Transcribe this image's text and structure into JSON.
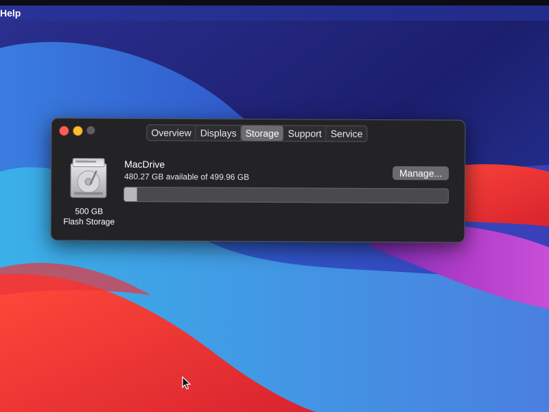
{
  "menubar": {
    "help_label": "Help"
  },
  "window": {
    "tabs": [
      {
        "label": "Overview",
        "active": false
      },
      {
        "label": "Displays",
        "active": false
      },
      {
        "label": "Storage",
        "active": true
      },
      {
        "label": "Support",
        "active": false
      },
      {
        "label": "Service",
        "active": false
      }
    ],
    "drive": {
      "icon": "hard-drive-icon",
      "capacity_label": "500 GB",
      "type_label": "Flash Storage",
      "name": "MacDrive",
      "availability_text": "480.27 GB available of 499.96 GB",
      "used_fraction": 0.039
    },
    "manage_label": "Manage..."
  },
  "colors": {
    "close": "#ff5f57",
    "minimize": "#febc2e",
    "window_bg": "#232326",
    "active_tab": "#6b6b70"
  }
}
